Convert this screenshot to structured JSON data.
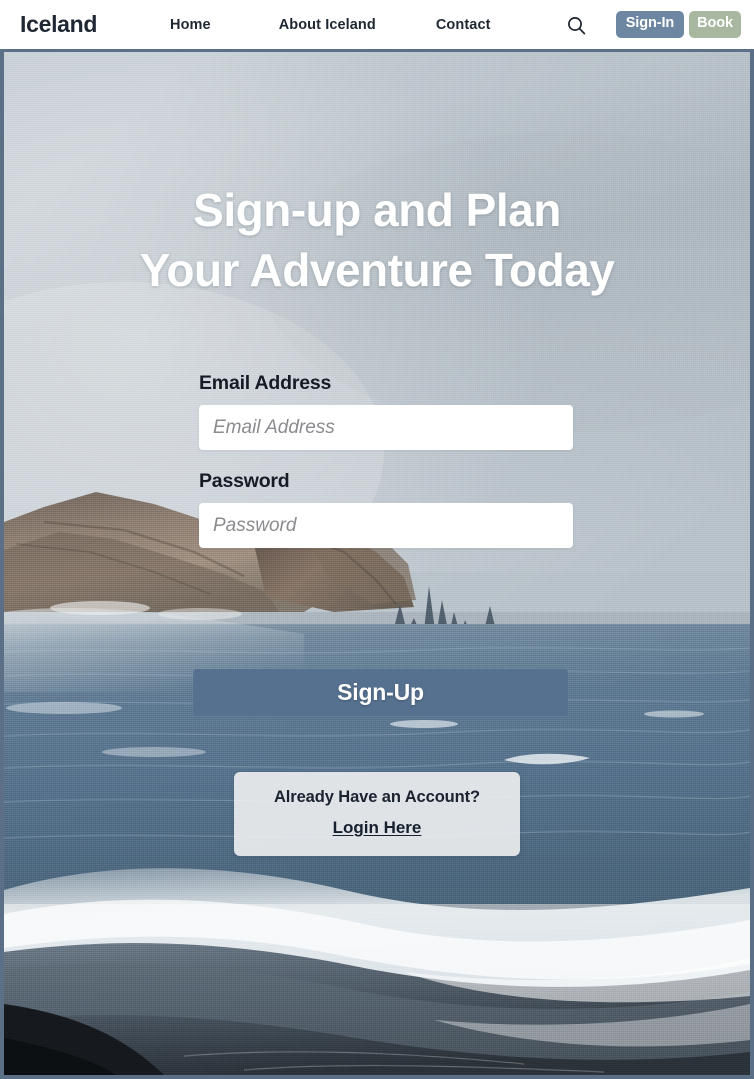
{
  "site": {
    "brand": "Iceland"
  },
  "nav": {
    "links": [
      {
        "label": "Home",
        "name": "nav-link-home"
      },
      {
        "label": "About Iceland",
        "name": "nav-link-about-iceland"
      },
      {
        "label": "Contact",
        "name": "nav-link-contact"
      }
    ],
    "search_icon": "search-icon",
    "signin_label": "Sign-In",
    "book_label": "Book",
    "signin_color": "#6d87a3",
    "book_color": "#a8b8a0",
    "text_color": "#1f2733"
  },
  "hero": {
    "headline_line1": "Sign-up and Plan",
    "headline_line2": "Your Adventure Today",
    "scene": "iceland-black-sand-beach-sea-stacks"
  },
  "form": {
    "email": {
      "label": "Email Address",
      "placeholder": "Email Address",
      "value": ""
    },
    "password": {
      "label": "Password",
      "placeholder": "Password",
      "value": ""
    },
    "submit_label": "Sign-Up",
    "submit_color": "#55718f"
  },
  "login_card": {
    "question": "Already Have an Account?",
    "link_label": "Login Here"
  },
  "theme": {
    "frame_color": "#5b7086",
    "heading_color": "#ffffff",
    "label_color": "#151c26",
    "placeholder_color": "#8b8b8f"
  }
}
